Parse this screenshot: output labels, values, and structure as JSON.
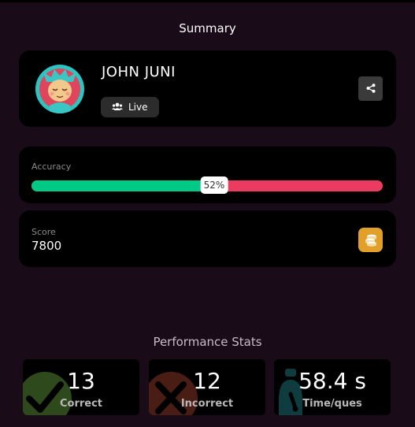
{
  "header": {
    "title": "Summary"
  },
  "profile": {
    "name": "JOHN JUNI",
    "status_label": "Live",
    "avatar_icon": "monster-avatar-icon",
    "share_icon": "share-icon"
  },
  "accuracy": {
    "label": "Accuracy",
    "percent": 52,
    "percent_label": "52%",
    "correct_color": "#00c985",
    "incorrect_color": "#ec3b61"
  },
  "score": {
    "label": "Score",
    "value": "7800",
    "icon": "coins-icon"
  },
  "performance": {
    "heading": "Performance Stats",
    "stats": [
      {
        "value": "13",
        "label": "Correct",
        "icon": "checkmark-icon",
        "color": "#6fae3a"
      },
      {
        "value": "12",
        "label": "Incorrect",
        "icon": "cross-icon",
        "color": "#d04a2c"
      },
      {
        "value": "58.4 s",
        "label": "Time/ques",
        "icon": "timer-icon",
        "color": "#1aa9a9"
      }
    ]
  }
}
